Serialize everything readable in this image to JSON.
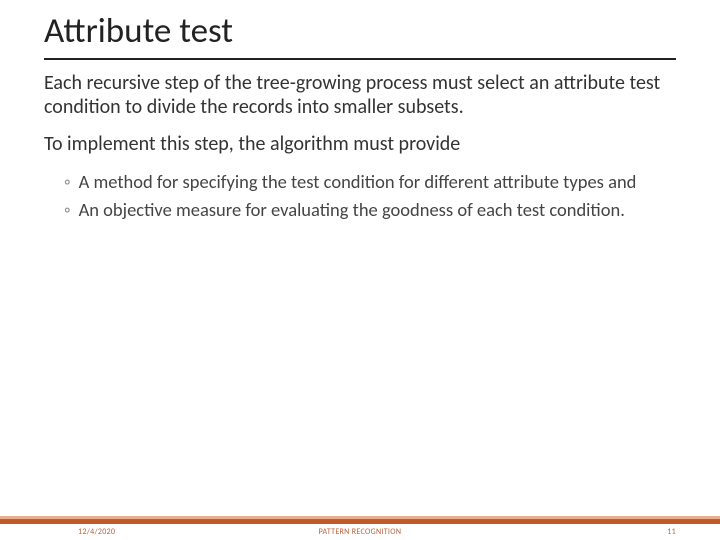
{
  "title": "Attribute test",
  "para1": "Each recursive step of the tree-growing process must select an attribute test condition to divide the records into smaller subsets.",
  "para2": "To implement this step, the algorithm must provide",
  "bullets": [
    "A method for specifying the test condition for different attribute types and",
    "An objective measure for evaluating the goodness of each test condition."
  ],
  "footer": {
    "date": "12/4/2020",
    "center": "PATTERN RECOGNITION",
    "page": "11"
  }
}
